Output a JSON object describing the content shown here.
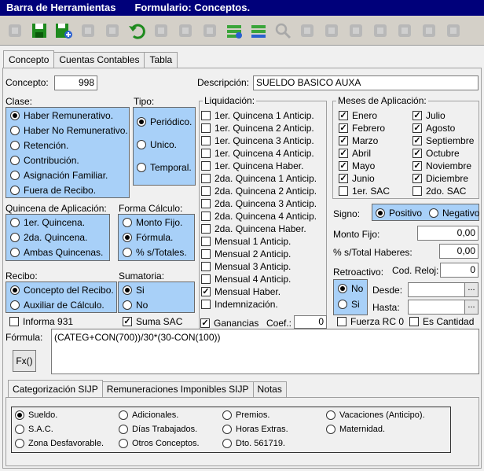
{
  "title_left": "Barra de Herramientas",
  "title_right": "Formulario: Conceptos.",
  "toolbar": [
    "first-record-icon",
    "save-icon",
    "save-new-icon",
    "edit-icon",
    "delete-icon",
    "undo-icon",
    "help-icon",
    "film-icon",
    "blank-icon",
    "add-rows-icon",
    "remove-rows-icon",
    "search-icon",
    "prev-first-icon",
    "prev-icon",
    "next-icon",
    "next-last-icon",
    "print-icon",
    "copy-icon",
    "home-icon"
  ],
  "tabs": [
    "Concepto",
    "Cuentas Contables",
    "Tabla"
  ],
  "concepto": {
    "label": "Concepto:",
    "value": "998"
  },
  "descripcion": {
    "label": "Descripción:",
    "value": "SUELDO BASICO AUXA"
  },
  "clase": {
    "label": "Clase:",
    "options": [
      "Haber Remunerativo.",
      "Haber No Remunerativo.",
      "Retención.",
      "Contribución.",
      "Asignación Familiar.",
      "Fuera de Recibo."
    ],
    "selected": 0
  },
  "tipo": {
    "label": "Tipo:",
    "options": [
      "Periódico.",
      "Unico.",
      "Temporal."
    ],
    "selected": 0
  },
  "liquidacion": {
    "label": "Liquidación:",
    "items": [
      "1er. Quincena 1 Anticip.",
      "1er. Quincena 2 Anticip.",
      "1er. Quincena 3 Anticip.",
      "1er. Quincena 4 Anticip.",
      "1er. Quincena Haber.",
      "2da. Quincena 1 Anticip.",
      "2da. Quincena 2 Anticip.",
      "2da. Quincena 3 Anticip.",
      "2da. Quincena 4 Anticip.",
      "2da. Quincena Haber.",
      "Mensual 1 Anticip.",
      "Mensual 2 Anticip.",
      "Mensual 3 Anticip.",
      "Mensual 4 Anticip.",
      "Mensual Haber.",
      "Indemnización."
    ],
    "checked": [
      false,
      false,
      false,
      false,
      false,
      false,
      false,
      false,
      false,
      false,
      false,
      false,
      false,
      false,
      true,
      false
    ]
  },
  "meses": {
    "label": "Meses de Aplicación:",
    "col1": [
      "Enero",
      "Febrero",
      "Marzo",
      "Abril",
      "Mayo",
      "Junio",
      "1er. SAC"
    ],
    "col2": [
      "Julio",
      "Agosto",
      "Septiembre",
      "Octubre",
      "Noviembre",
      "Diciembre",
      "2do. SAC"
    ],
    "checked1": [
      true,
      true,
      true,
      true,
      true,
      true,
      false
    ],
    "checked2": [
      true,
      true,
      true,
      true,
      true,
      true,
      false
    ]
  },
  "signo": {
    "label": "Signo:",
    "options": [
      "Positivo",
      "Negativo"
    ],
    "selected": 0
  },
  "monto_fijo": {
    "label": "Monto Fijo:",
    "value": "0,00"
  },
  "pct_total": {
    "label": "% s/Total Haberes:",
    "value": "0,00"
  },
  "retroactivo": {
    "label": "Retroactivo:",
    "options": [
      "No",
      "Si"
    ],
    "selected": 0
  },
  "cod_reloj": {
    "label": "Cod. Reloj:",
    "value": "0"
  },
  "desde": {
    "label": "Desde:",
    "value": "",
    "btn": "..."
  },
  "hasta": {
    "label": "Hasta:",
    "value": "",
    "btn": "..."
  },
  "quincena": {
    "label": "Quincena de Aplicación:",
    "options": [
      "1er. Quincena.",
      "2da. Quincena.",
      "Ambas Quincenas."
    ],
    "selected": -1
  },
  "forma": {
    "label": "Forma Cálculo:",
    "options": [
      "Monto Fijo.",
      "Fórmula.",
      "% s/Totales."
    ],
    "selected": 1
  },
  "recibo": {
    "label": "Recibo:",
    "options": [
      "Concepto del Recibo.",
      "Auxiliar de Cálculo."
    ],
    "selected": 0
  },
  "sumatoria": {
    "label": "Sumatoria:",
    "options": [
      "Si",
      "No"
    ],
    "selected": 0
  },
  "informa931": {
    "label": "Informa 931",
    "checked": false
  },
  "suma_sac": {
    "label": "Suma SAC",
    "checked": true
  },
  "ganancias": {
    "label": "Ganancias",
    "checked": true
  },
  "coef": {
    "label": "Coef.:",
    "value": "0"
  },
  "fuerza_rc": {
    "label": "Fuerza RC 0",
    "checked": false
  },
  "es_cantidad": {
    "label": "Es Cantidad",
    "checked": false
  },
  "formula": {
    "label": "Fórmula:",
    "value": "(CATEG+CON(700))/30*(30-CON(100))",
    "btn": "Fx()"
  },
  "inner_tabs": [
    "Categorización SIJP",
    "Remuneraciones Imponibles SIJP",
    "Notas"
  ],
  "sijp": {
    "options": [
      "Sueldo.",
      "Adicionales.",
      "Premios.",
      "Vacaciones (Anticipo).",
      "S.A.C.",
      "Días Trabajados.",
      "Horas Extras.",
      "Maternidad.",
      "Zona Desfavorable.",
      "Otros Conceptos.",
      "Dto. 561719."
    ],
    "selected": 0
  }
}
